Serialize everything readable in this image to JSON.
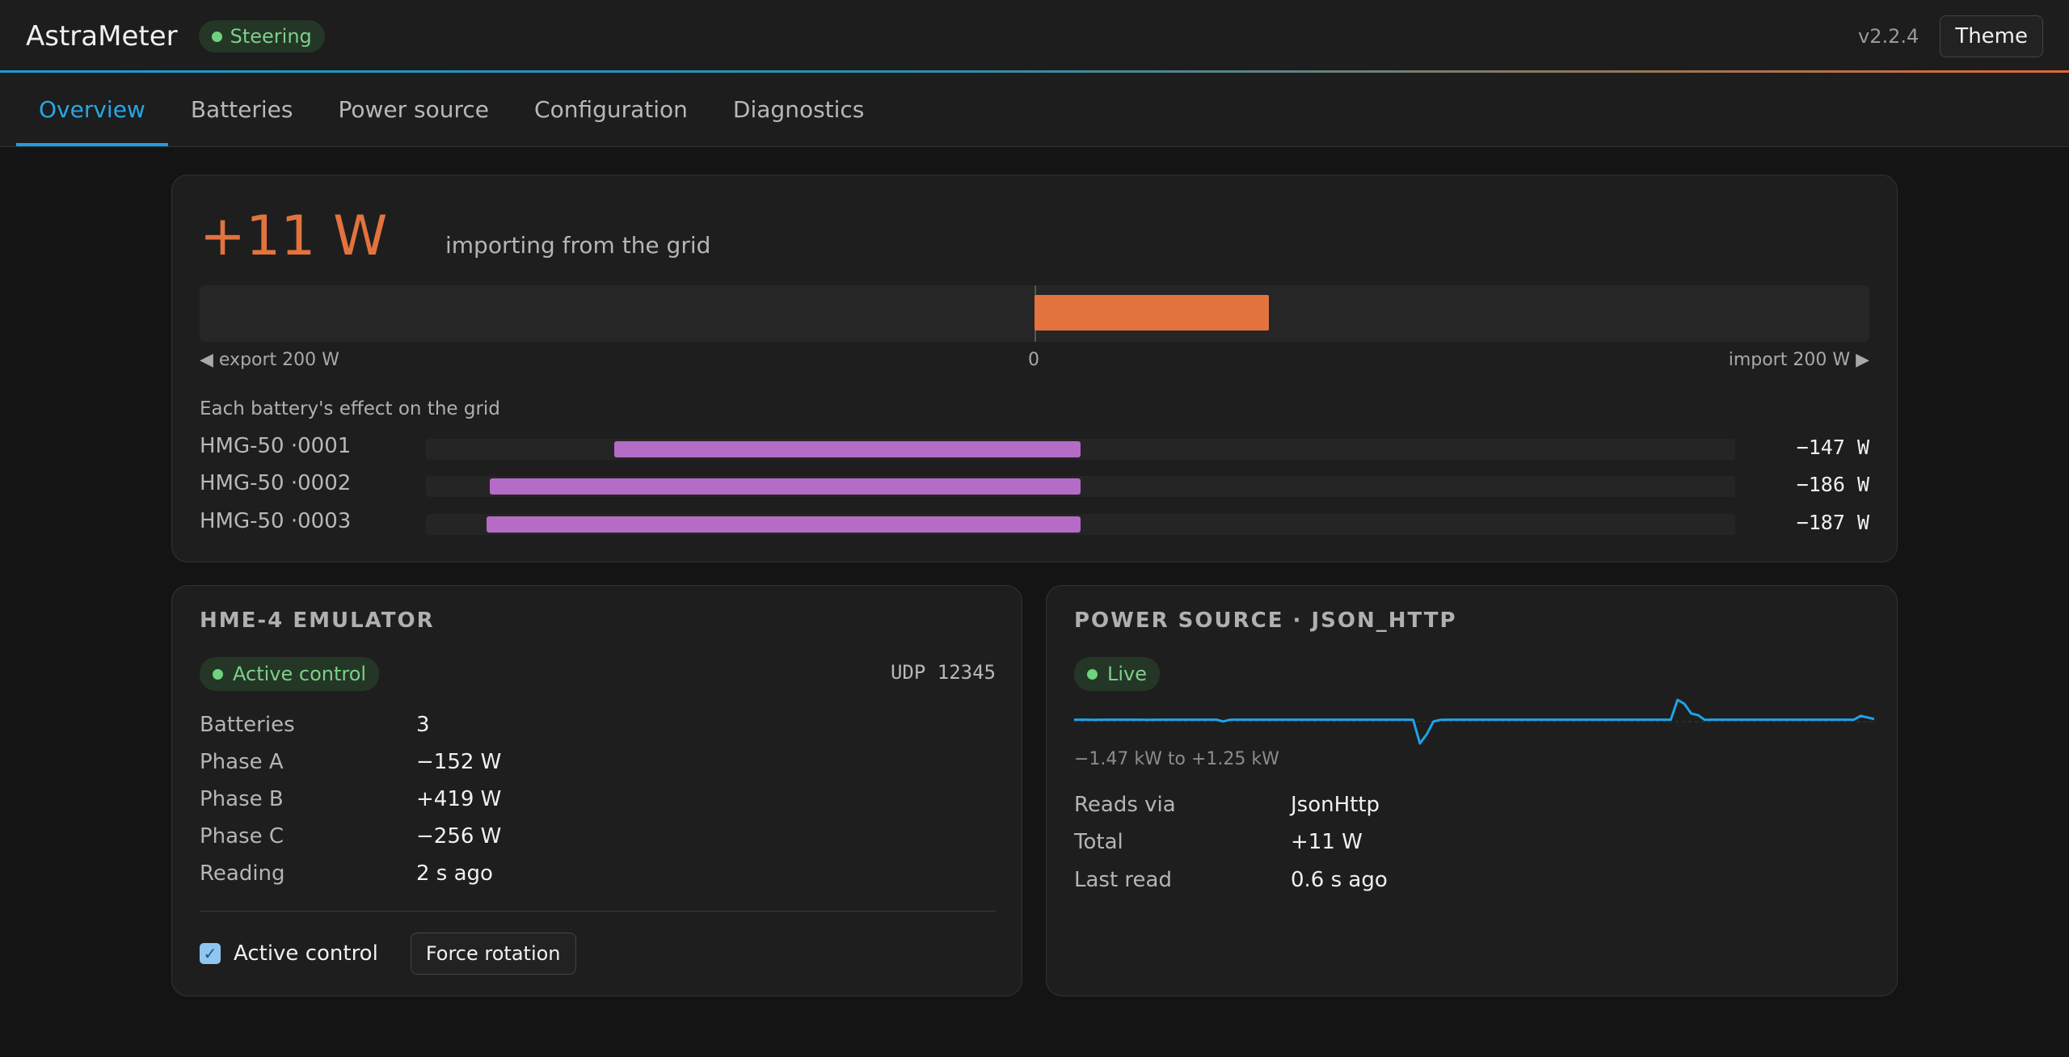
{
  "header": {
    "app_title": "AstraMeter",
    "mode_badge": "Steering",
    "version": "v2.2.4",
    "theme_button": "Theme"
  },
  "tabs": [
    {
      "label": "Overview",
      "active": true
    },
    {
      "label": "Batteries",
      "active": false
    },
    {
      "label": "Power source",
      "active": false
    },
    {
      "label": "Configuration",
      "active": false
    },
    {
      "label": "Diagnostics",
      "active": false
    }
  ],
  "grid": {
    "value": "+11 W",
    "description": "importing from the grid",
    "gauge_min_label": "◀ export 200 W",
    "gauge_zero_label": "0",
    "gauge_max_label": "import 200 W ▶",
    "gauge_range_w": 200,
    "gauge_value_w": 11,
    "batteries_heading": "Each battery's effect on the grid",
    "batteries": [
      {
        "name": "HMG-50 ·0001",
        "value": "−147 W",
        "watts": -147
      },
      {
        "name": "HMG-50 ·0002",
        "value": "−186 W",
        "watts": -186
      },
      {
        "name": "HMG-50 ·0003",
        "value": "−187 W",
        "watts": -187
      }
    ],
    "battery_scale_w": 200
  },
  "emulator": {
    "title": "HME-4 EMULATOR",
    "status": "Active control",
    "port": "UDP 12345",
    "rows": [
      {
        "key": "Batteries",
        "value": "3"
      },
      {
        "key": "Phase A",
        "value": "−152 W"
      },
      {
        "key": "Phase B",
        "value": "+419 W"
      },
      {
        "key": "Phase C",
        "value": "−256 W"
      },
      {
        "key": "Reading",
        "value": "2 s ago"
      }
    ],
    "active_control_label": "Active control",
    "active_control_checked": true,
    "force_rotation_button": "Force rotation"
  },
  "power_source": {
    "title": "POWER SOURCE · JSON_HTTP",
    "status": "Live",
    "range_text": "−1.47 kW to +1.25 kW",
    "sparkline_kw": [
      0.01,
      0.01,
      0.01,
      0.0,
      0.01,
      0.01,
      0.01,
      0.01,
      0.01,
      0.01,
      0.01,
      0.0,
      0.01,
      0.01,
      0.01,
      0.01,
      0.01,
      0.01,
      0.01,
      0.01,
      0.01,
      0.01,
      -0.1,
      0.01,
      0.01,
      0.01,
      0.01,
      0.01,
      0.01,
      0.01,
      0.01,
      0.01,
      0.01,
      0.01,
      0.01,
      0.01,
      0.01,
      0.01,
      0.01,
      0.01,
      0.01,
      0.01,
      0.01,
      0.01,
      0.01,
      0.01,
      0.01,
      0.01,
      0.01,
      0.01,
      0.01,
      -1.47,
      -0.9,
      -0.1,
      0.0,
      0.01,
      0.01,
      0.01,
      0.01,
      0.01,
      0.01,
      0.01,
      0.01,
      0.01,
      0.01,
      0.01,
      0.01,
      0.01,
      0.01,
      0.01,
      0.01,
      0.01,
      0.01,
      0.01,
      0.01,
      0.01,
      0.01,
      0.01,
      0.01,
      0.01,
      0.01,
      0.01,
      0.01,
      0.01,
      0.01,
      0.01,
      0.01,
      0.01,
      0.01,
      1.25,
      1.0,
      0.4,
      0.3,
      0.0,
      0.01,
      0.01,
      0.01,
      0.01,
      0.01,
      0.01,
      0.01,
      0.01,
      0.01,
      0.01,
      0.01,
      0.01,
      0.01,
      0.01,
      0.01,
      0.01,
      0.01,
      0.01,
      0.01,
      0.01,
      0.01,
      0.01,
      0.25,
      0.15,
      0.05
    ],
    "sparkline_color": "#1fa3e8",
    "rows": [
      {
        "key": "Reads via",
        "value": "JsonHttp"
      },
      {
        "key": "Total",
        "value": "+11 W"
      },
      {
        "key": "Last read",
        "value": "0.6 s ago"
      }
    ]
  },
  "colors": {
    "accent": "#1f9ee0",
    "import": "#e3733e",
    "battery": "#b56cc7",
    "ok": "#7dcf8a"
  },
  "icons": {
    "status_dot": "green-dot-icon",
    "checkbox": "checkmark-icon"
  }
}
